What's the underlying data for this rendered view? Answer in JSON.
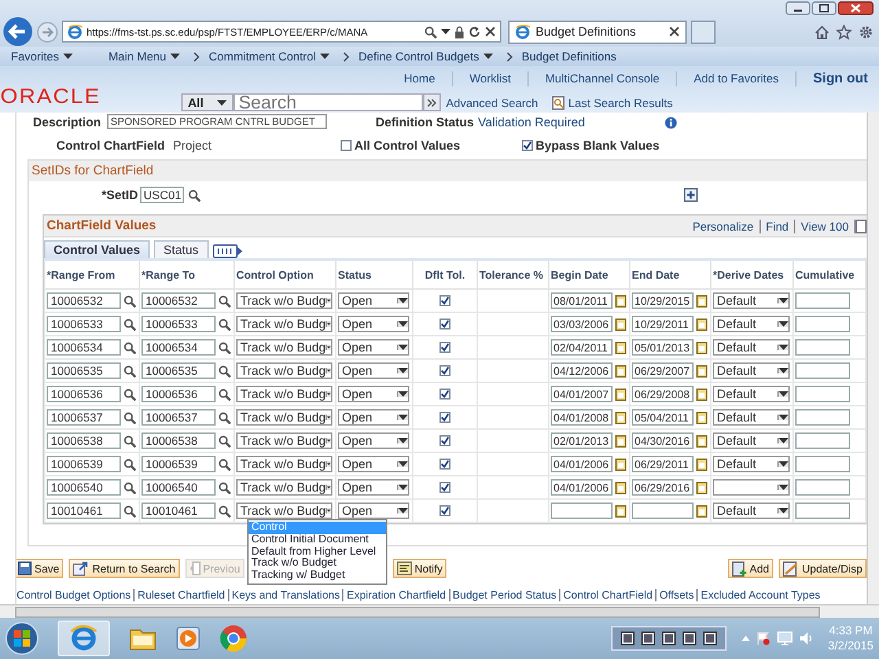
{
  "browser": {
    "url": "https://fms-tst.ps.sc.edu/psp/FTST/EMPLOYEE/ERP/c/MANA",
    "tab_title": "Budget Definitions"
  },
  "nav": {
    "favorites": "Favorites",
    "breadcrumbs": [
      "Main Menu",
      "Commitment Control",
      "Define Control Budgets",
      "Budget Definitions"
    ]
  },
  "header": {
    "logo": "ORACLE",
    "links": [
      "Home",
      "Worklist",
      "MultiChannel Console",
      "Add to Favorites",
      "Sign out"
    ],
    "search": {
      "scope": "All",
      "placeholder": "Search"
    },
    "advanced_search": "Advanced Search",
    "last_search": "Last Search Results"
  },
  "page": {
    "description_label": "Description",
    "description_value": "SPONSORED PROGRAM CNTRL BUDGET",
    "status_label": "Definition Status",
    "status_value": "Validation Required",
    "chartfield_label": "Control ChartField",
    "chartfield_value": "Project",
    "options": [
      {
        "label": "All Control Values",
        "checked": false
      },
      {
        "label": "Bypass Blank Values",
        "checked": true
      }
    ]
  },
  "setids": {
    "title": "SetIDs for ChartField",
    "setid_label": "*SetID",
    "setid_value": "USC01"
  },
  "grid": {
    "title": "ChartField Values",
    "actions": [
      "Personalize",
      "Find",
      "View 100"
    ],
    "tabs": [
      {
        "label": "Control Values",
        "selected": true
      },
      {
        "label": "Status",
        "selected": false
      }
    ],
    "columns": [
      "*Range From",
      "*Range To",
      "Control Option",
      "Status",
      "Dflt Tol.",
      "Tolerance %",
      "Begin Date",
      "End Date",
      "*Derive Dates",
      "Cumulative"
    ],
    "rows": [
      {
        "range_from": "10006532",
        "range_to": "10006532",
        "control_option": "Track w/o Budg",
        "status": "Open",
        "dflt_tol": true,
        "begin_date": "08/01/2011",
        "end_date": "10/29/2015",
        "derive_dates": "Default"
      },
      {
        "range_from": "10006533",
        "range_to": "10006533",
        "control_option": "Track w/o Budg",
        "status": "Open",
        "dflt_tol": true,
        "begin_date": "03/03/2006",
        "end_date": "10/29/2011",
        "derive_dates": "Default"
      },
      {
        "range_from": "10006534",
        "range_to": "10006534",
        "control_option": "Track w/o Budg",
        "status": "Open",
        "dflt_tol": true,
        "begin_date": "02/04/2011",
        "end_date": "05/01/2013",
        "derive_dates": "Default"
      },
      {
        "range_from": "10006535",
        "range_to": "10006535",
        "control_option": "Track w/o Budg",
        "status": "Open",
        "dflt_tol": true,
        "begin_date": "04/12/2006",
        "end_date": "06/29/2007",
        "derive_dates": "Default"
      },
      {
        "range_from": "10006536",
        "range_to": "10006536",
        "control_option": "Track w/o Budg",
        "status": "Open",
        "dflt_tol": true,
        "begin_date": "04/01/2007",
        "end_date": "06/29/2008",
        "derive_dates": "Default"
      },
      {
        "range_from": "10006537",
        "range_to": "10006537",
        "control_option": "Track w/o Budg",
        "status": "Open",
        "dflt_tol": true,
        "begin_date": "04/01/2008",
        "end_date": "05/04/2011",
        "derive_dates": "Default"
      },
      {
        "range_from": "10006538",
        "range_to": "10006538",
        "control_option": "Track w/o Budg",
        "status": "Open",
        "dflt_tol": true,
        "begin_date": "02/01/2013",
        "end_date": "04/30/2016",
        "derive_dates": "Default"
      },
      {
        "range_from": "10006539",
        "range_to": "10006539",
        "control_option": "Track w/o Budg",
        "status": "Open",
        "dflt_tol": true,
        "begin_date": "04/01/2006",
        "end_date": "06/29/2011",
        "derive_dates": "Default"
      },
      {
        "range_from": "10006540",
        "range_to": "10006540",
        "control_option": "Track w/o Budg",
        "status": "Open",
        "dflt_tol": true,
        "begin_date": "04/01/2006",
        "end_date": "06/29/2016"
      },
      {
        "range_from": "10010461",
        "range_to": "10010461",
        "control_option": "Track w/o Budg",
        "status": "Open",
        "dflt_tol": true,
        "derive_dates": "Default"
      }
    ],
    "dropdown": [
      {
        "label": "Control",
        "selected": true
      },
      {
        "label": "Control Initial Document",
        "selected": false
      },
      {
        "label": "Default from Higher Level",
        "selected": false
      },
      {
        "label": "Track w/o Budget",
        "selected": false
      },
      {
        "label": "Tracking w/ Budget",
        "selected": false
      }
    ]
  },
  "buttons": [
    {
      "label": "Save",
      "kind": "save",
      "disabled": false
    },
    {
      "label": "Return to Search",
      "kind": "return",
      "disabled": false
    },
    {
      "label": "Previou",
      "kind": "previous",
      "disabled": true
    },
    {
      "label": "Notify",
      "kind": "notify",
      "disabled": false
    },
    {
      "label": "Add",
      "kind": "add",
      "disabled": false
    },
    {
      "label": "Update/Disp",
      "kind": "update",
      "disabled": false
    }
  ],
  "links": [
    "Control Budget Options",
    "Ruleset Chartfield",
    "Keys and Translations",
    "Expiration Chartfield",
    "Budget Period Status",
    "Control ChartField",
    "Offsets",
    "Excluded Account Types"
  ],
  "taskbar": {
    "time": "4:33 PM",
    "date": "3/2/2015"
  }
}
